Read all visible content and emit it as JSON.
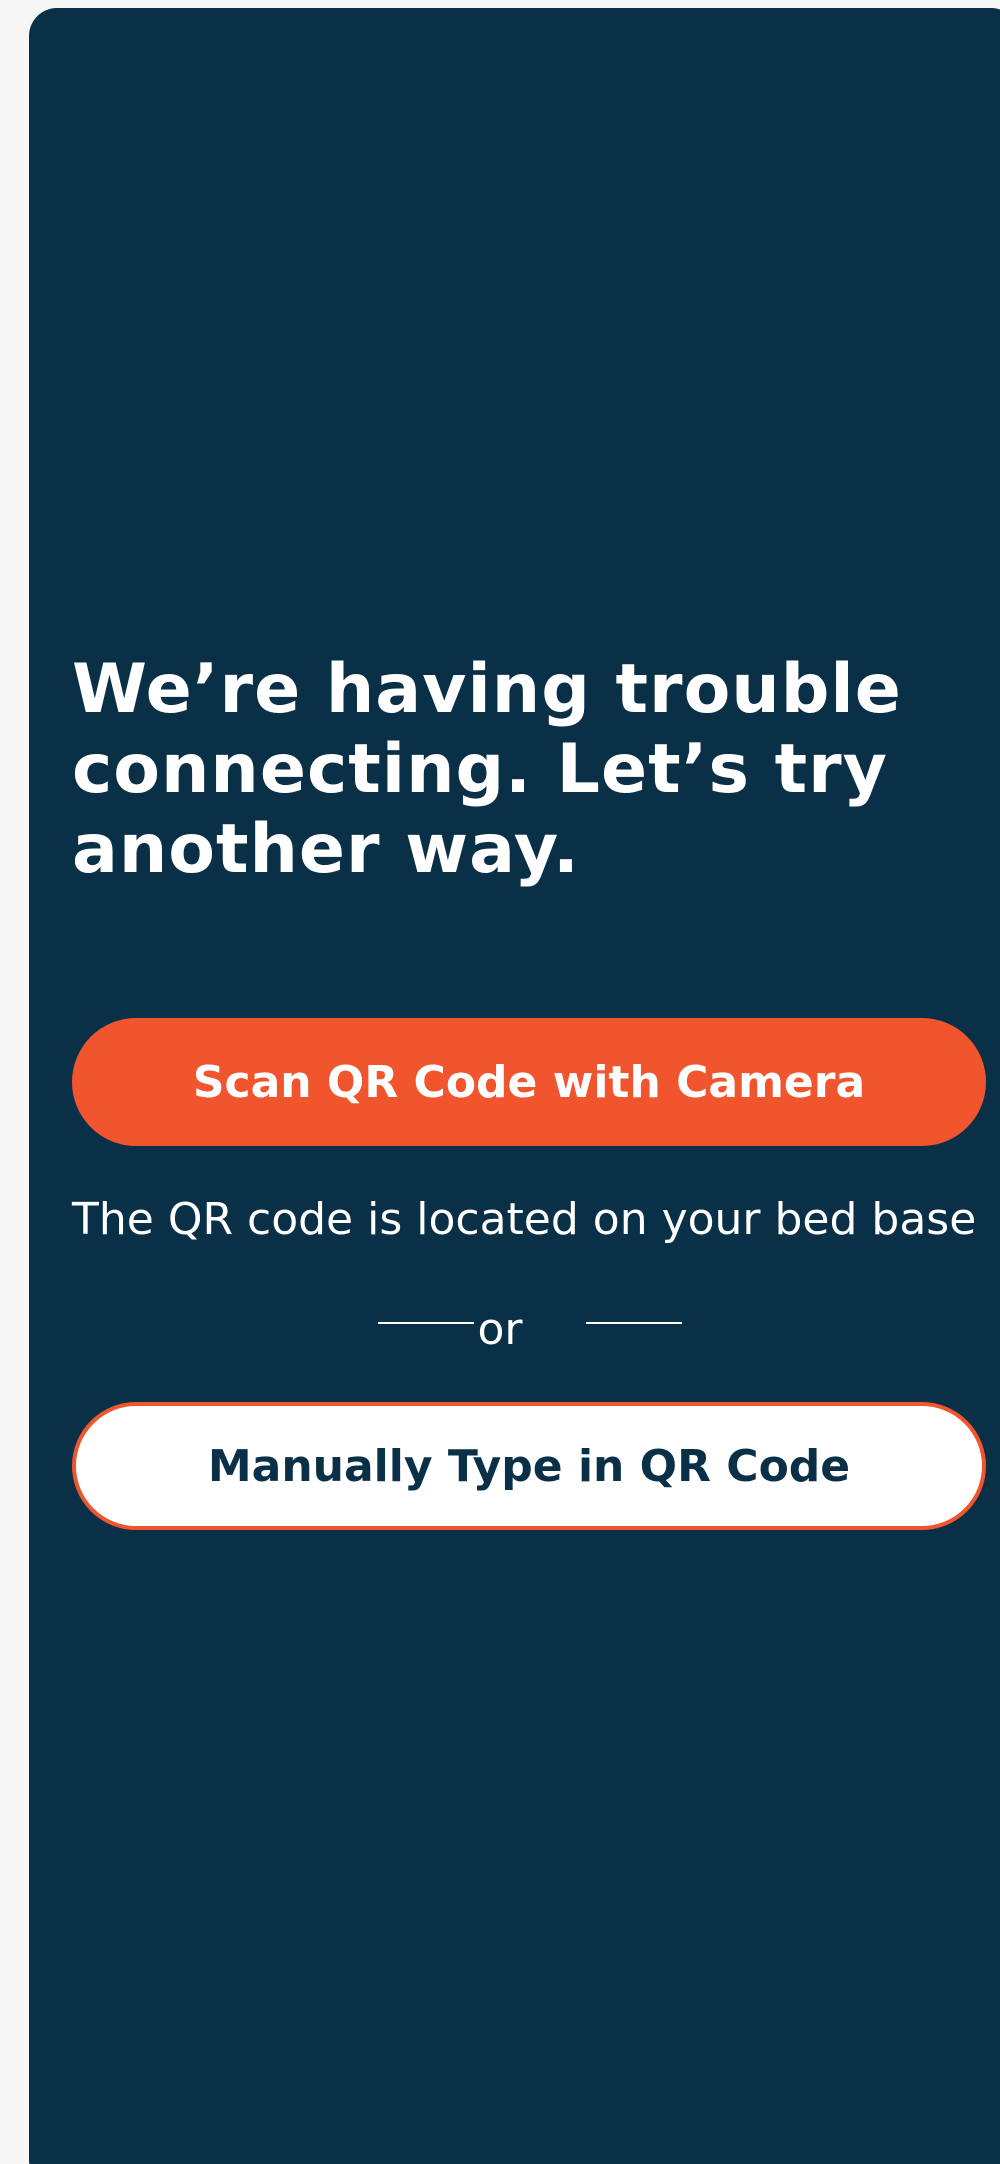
{
  "screen": {
    "heading": "We’re having trouble connecting. Let’s try another way.",
    "primary_button_label": "Scan QR Code with Camera",
    "hint_text": "The QR code is located on your bed base",
    "divider_text": "or",
    "secondary_button_label": "Manually Type in QR Code"
  },
  "colors": {
    "background": "#0a3047",
    "accent": "#f0552e",
    "text": "#ffffff"
  }
}
